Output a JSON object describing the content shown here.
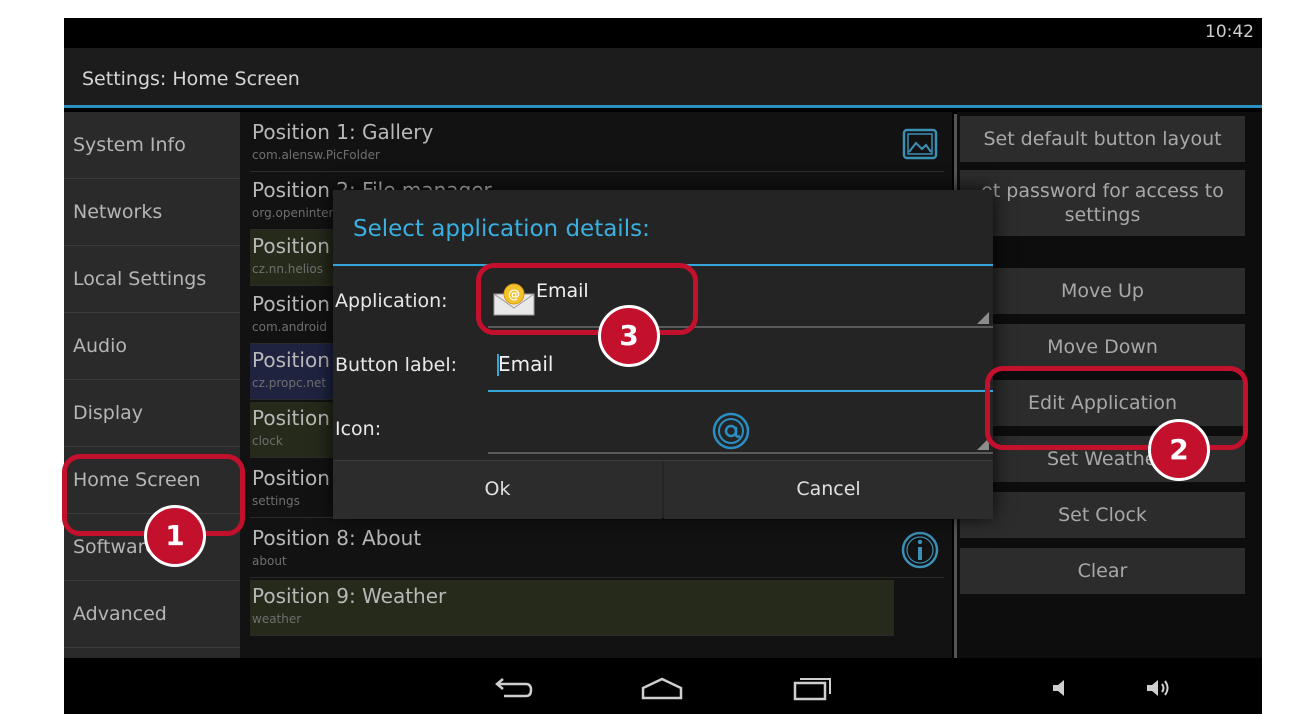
{
  "status_bar": {
    "time": "10:42"
  },
  "action_bar": {
    "title": "Settings: Home Screen"
  },
  "sidebar": {
    "items": [
      {
        "label": "System Info"
      },
      {
        "label": "Networks"
      },
      {
        "label": "Local Settings"
      },
      {
        "label": "Audio"
      },
      {
        "label": "Display"
      },
      {
        "label": "Home Screen",
        "active": true
      },
      {
        "label": "Software"
      },
      {
        "label": "Advanced"
      }
    ]
  },
  "positions": [
    {
      "title": "Position 1: Gallery",
      "package": "com.alensw.PicFolder",
      "icon": "gallery-icon"
    },
    {
      "title": "Position 2: File manager",
      "package": "org.openintents"
    },
    {
      "title": "Position",
      "package": "cz.nn.helios"
    },
    {
      "title": "Position",
      "package": "com.android"
    },
    {
      "title": "Position",
      "package": "cz.propc.net"
    },
    {
      "title": "Position",
      "package": "clock"
    },
    {
      "title": "Position",
      "package": "settings"
    },
    {
      "title": "Position 8: About",
      "package": "about",
      "icon": "info-icon"
    },
    {
      "title": "Position 9: Weather",
      "package": "weather"
    }
  ],
  "right_panel": {
    "buttons": [
      {
        "label": "Set default button layout"
      },
      {
        "label": "et password for access to settings"
      },
      {
        "label": "Move Up"
      },
      {
        "label": "Move Down"
      },
      {
        "label": "Edit Application"
      },
      {
        "label": "Set Weathe"
      },
      {
        "label": "Set Clock"
      },
      {
        "label": "Clear"
      }
    ]
  },
  "dialog": {
    "title": "Select application details:",
    "application_label": "Application:",
    "application_value": "Email",
    "button_label_label": "Button label:",
    "button_label_value": "Email",
    "icon_label": "Icon:",
    "ok": "Ok",
    "cancel": "Cancel"
  },
  "nav_bar": {
    "icons": [
      "back-icon",
      "home-icon",
      "recent-apps-icon",
      "volume-down-icon",
      "volume-up-icon"
    ]
  },
  "annotations": {
    "badges": [
      "1",
      "2",
      "3"
    ],
    "color": "#c3102d"
  },
  "colors": {
    "accent": "#36a6d8",
    "background": "#000000"
  }
}
